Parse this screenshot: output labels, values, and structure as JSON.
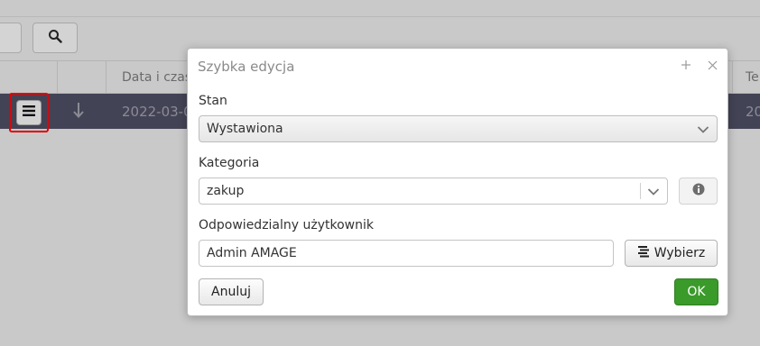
{
  "background": {
    "search_icon": "search-icon",
    "table_headers": [
      "Data i czas",
      "Te"
    ],
    "row_values": [
      "2022-03-0",
      "20"
    ],
    "row_menu_icon": "hamburger-icon",
    "row_sort_icon": "arrow-down-icon"
  },
  "dialog": {
    "title": "Szybka edycja",
    "expand_icon": "plus-icon",
    "close_icon": "close-icon",
    "status": {
      "label": "Stan",
      "value": "Wystawiona"
    },
    "category": {
      "label": "Kategoria",
      "value": "zakup",
      "info_icon": "info-icon"
    },
    "responsible": {
      "label": "Odpowiedzialny użytkownik",
      "value": "Admin AMAGE",
      "choose_label": "Wybierz",
      "choose_icon": "list-icon"
    },
    "cancel_label": "Anuluj",
    "ok_label": "OK"
  },
  "colors": {
    "overlay": "#c9c9c9",
    "selected_row": "#434356",
    "highlight_border": "#e60000",
    "ok_button": "#3a9a2a"
  }
}
